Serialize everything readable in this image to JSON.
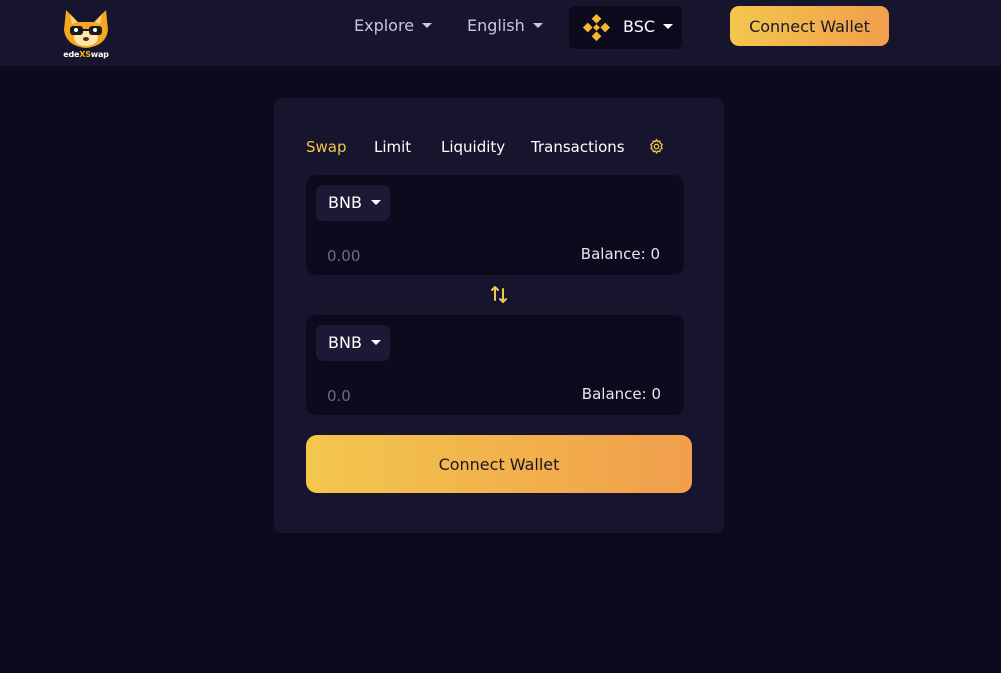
{
  "header": {
    "logo": {
      "text_part1": "ede",
      "text_part2": "XS",
      "text_part3": "wap",
      "icon": "fox-mascot-icon"
    },
    "nav": [
      {
        "label": "Explore"
      },
      {
        "label": "English"
      }
    ],
    "network": {
      "label": "BSC",
      "icon": "binance-icon"
    },
    "connect_label": "Connect Wallet"
  },
  "swap": {
    "tabs": [
      {
        "label": "Swap",
        "active": true
      },
      {
        "label": "Limit",
        "active": false
      },
      {
        "label": "Liquidity",
        "active": false
      },
      {
        "label": "Transactions",
        "active": false
      }
    ],
    "settings_icon": "gear-icon",
    "from": {
      "token": "BNB",
      "placeholder": "0.00",
      "balance": "Balance: 0"
    },
    "to": {
      "token": "BNB",
      "placeholder": "0.0",
      "balance": "Balance: 0"
    },
    "switch_icon": "swap-arrows-icon",
    "connect_label": "Connect Wallet"
  },
  "colors": {
    "background": "#0c0a1d",
    "header": "#17142d",
    "card": "#17142d",
    "accent": "#f3c74d",
    "accent_end": "#f19e4c"
  }
}
